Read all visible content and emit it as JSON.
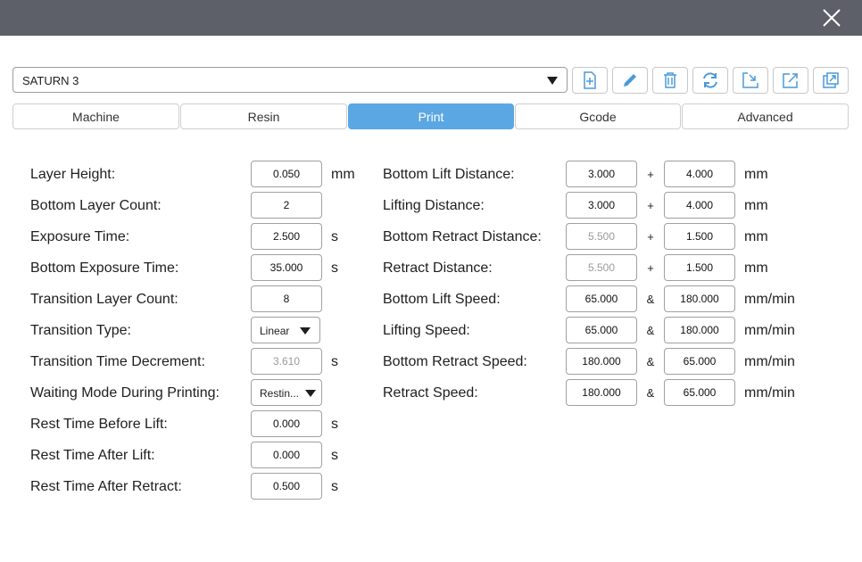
{
  "profile": {
    "value": "SATURN 3"
  },
  "toolbar": {
    "new_icon": "file-plus-icon",
    "edit_icon": "pencil-icon",
    "delete_icon": "trash-icon",
    "refresh_icon": "refresh-icon",
    "import_icon": "import-icon",
    "export_icon": "export-icon",
    "share_icon": "share-icon",
    "accent": "#4a9ad8"
  },
  "tabs": [
    {
      "label": "Machine"
    },
    {
      "label": "Resin"
    },
    {
      "label": "Print"
    },
    {
      "label": "Gcode"
    },
    {
      "label": "Advanced"
    }
  ],
  "colors": {
    "active_tab": "#5ba7e3",
    "titlebar": "#5d6068"
  },
  "left": {
    "layer_height": {
      "label": "Layer Height:",
      "value": "0.050",
      "unit": "mm"
    },
    "bottom_layer_count": {
      "label": "Bottom Layer Count:",
      "value": "2"
    },
    "exposure_time": {
      "label": "Exposure Time:",
      "value": "2.500",
      "unit": "s"
    },
    "bottom_exposure_time": {
      "label": "Bottom Exposure Time:",
      "value": "35.000",
      "unit": "s"
    },
    "transition_layer_count": {
      "label": "Transition Layer Count:",
      "value": "8"
    },
    "transition_type": {
      "label": "Transition Type:",
      "value": "Linear"
    },
    "transition_time_decrement": {
      "label": "Transition Time Decrement:",
      "value": "3.610",
      "unit": "s"
    },
    "waiting_mode": {
      "label": "Waiting Mode During Printing:",
      "value": "Restin..."
    },
    "rest_before_lift": {
      "label": "Rest Time Before Lift:",
      "value": "0.000",
      "unit": "s"
    },
    "rest_after_lift": {
      "label": "Rest Time After Lift:",
      "value": "0.000",
      "unit": "s"
    },
    "rest_after_retract": {
      "label": "Rest Time After Retract:",
      "value": "0.500",
      "unit": "s"
    }
  },
  "right": {
    "bottom_lift_distance": {
      "label": "Bottom Lift Distance:",
      "a": "3.000",
      "op": "+",
      "b": "4.000",
      "unit": "mm"
    },
    "lifting_distance": {
      "label": "Lifting Distance:",
      "a": "3.000",
      "op": "+",
      "b": "4.000",
      "unit": "mm"
    },
    "bottom_retract_distance": {
      "label": "Bottom Retract Distance:",
      "a": "5.500",
      "op": "+",
      "b": "1.500",
      "unit": "mm"
    },
    "retract_distance": {
      "label": "Retract Distance:",
      "a": "5.500",
      "op": "+",
      "b": "1.500",
      "unit": "mm"
    },
    "bottom_lift_speed": {
      "label": "Bottom Lift Speed:",
      "a": "65.000",
      "op": "&",
      "b": "180.000",
      "unit": "mm/min"
    },
    "lifting_speed": {
      "label": "Lifting Speed:",
      "a": "65.000",
      "op": "&",
      "b": "180.000",
      "unit": "mm/min"
    },
    "bottom_retract_speed": {
      "label": "Bottom Retract Speed:",
      "a": "180.000",
      "op": "&",
      "b": "65.000",
      "unit": "mm/min"
    },
    "retract_speed": {
      "label": "Retract Speed:",
      "a": "180.000",
      "op": "&",
      "b": "65.000",
      "unit": "mm/min"
    }
  }
}
